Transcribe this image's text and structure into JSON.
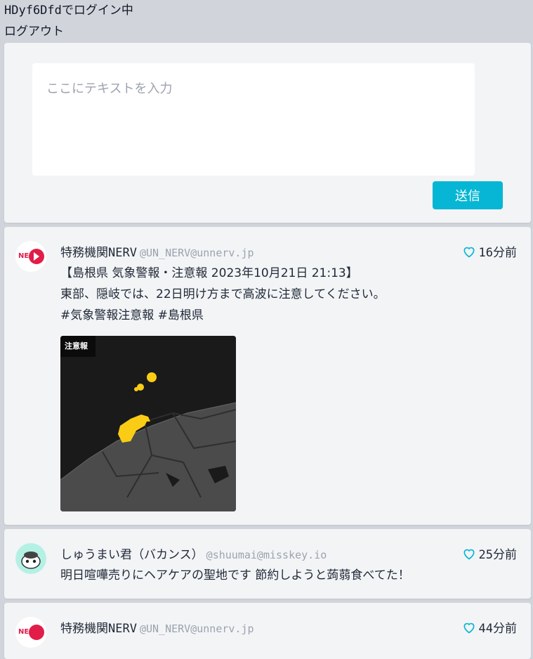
{
  "account": {
    "login_status": "HDyf6Dfdでログイン中",
    "logout_label": "ログアウト"
  },
  "composer": {
    "placeholder": "ここにテキストを入力",
    "send_label": "送信"
  },
  "notes": [
    {
      "display_name": "特務機関NERV",
      "handle": "@UN_NERV@unnerv.jp",
      "time": "16分前",
      "text": "【島根県 気象警報・注意報 2023年10月21日 21:13】\n東部、隠岐では、22日明け方まで高波に注意してください。\n#気象警報注意報 #島根県",
      "attachment": {
        "badge": "注意報"
      }
    },
    {
      "display_name": "しゅうまい君（バカンス）",
      "handle": "@shuumai@misskey.io",
      "time": "25分前",
      "text": "明日喧嘩売りにヘアケアの聖地です 節約しようと蒟蒻食べてた！"
    },
    {
      "display_name": "特務機関NERV",
      "handle": "@UN_NERV@unnerv.jp",
      "time": "44分前",
      "text": ""
    }
  ],
  "colors": {
    "accent": "#06b6d4",
    "background": "#d1d5db",
    "card": "#f3f4f6",
    "nerv_red": "#e11d48",
    "alert_yellow": "#facc15"
  }
}
